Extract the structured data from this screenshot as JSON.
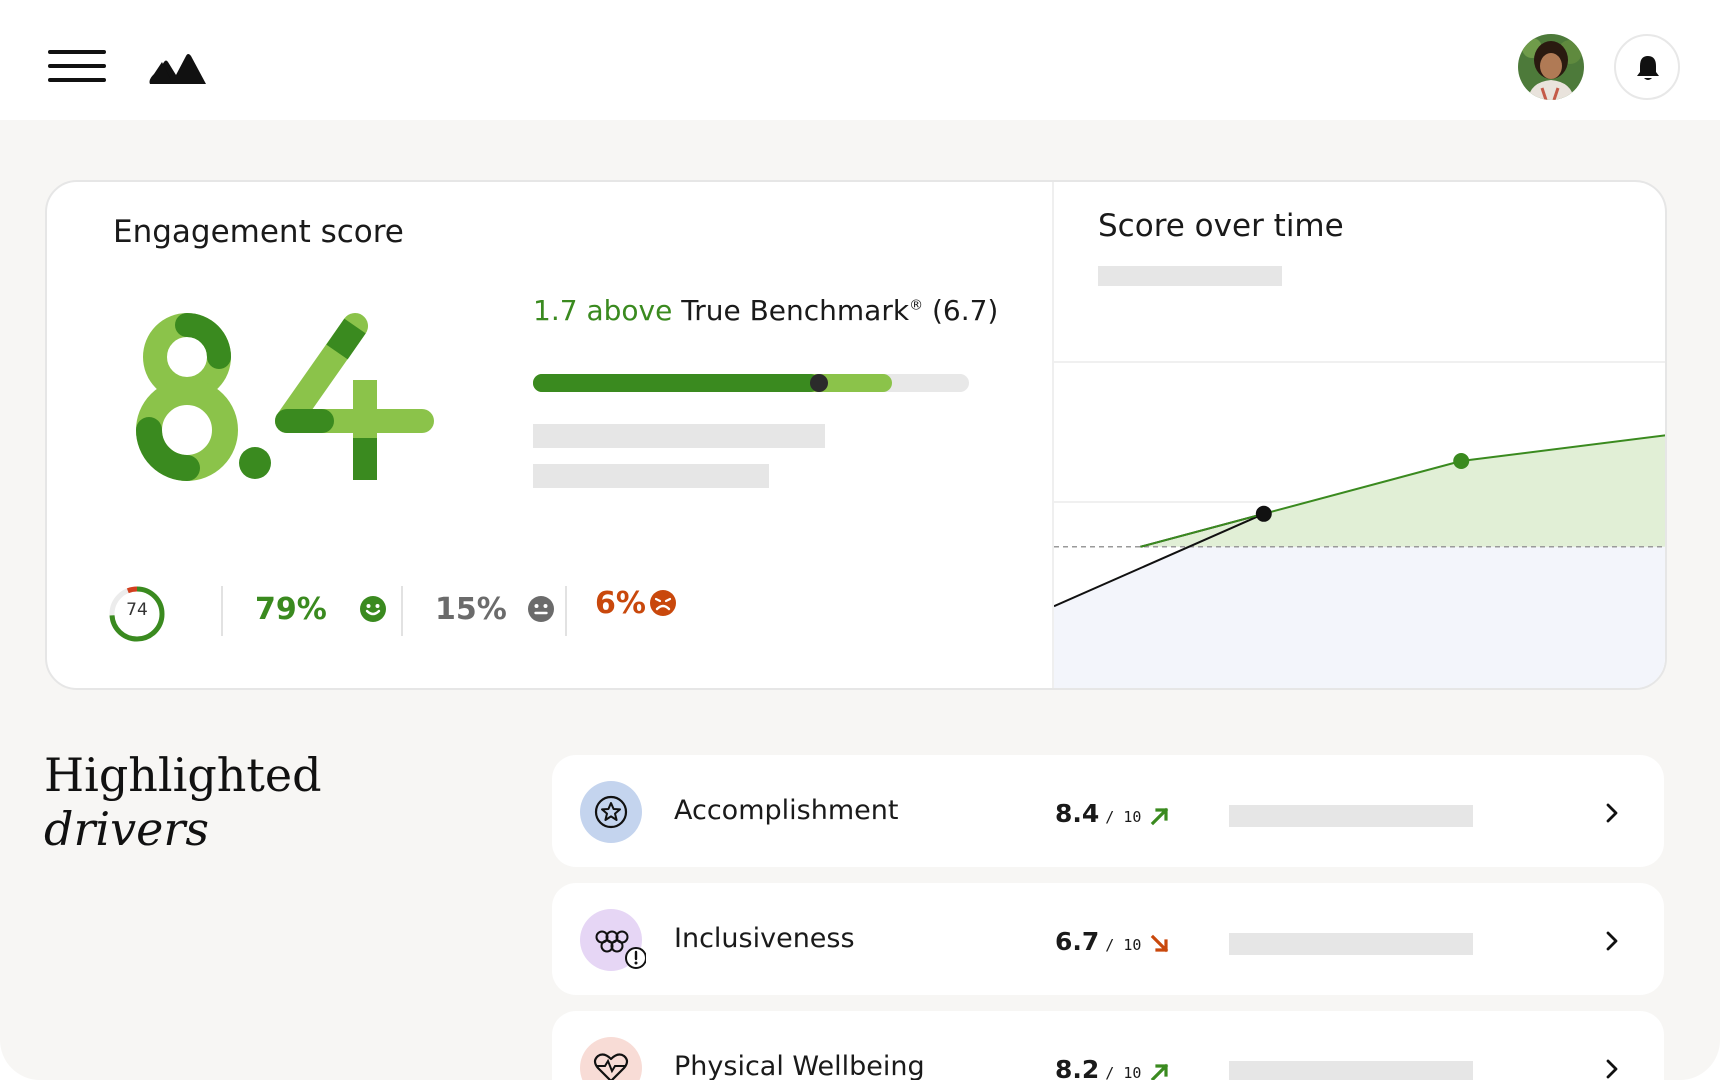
{
  "header": {
    "menu_icon": "hamburger-icon",
    "logo_icon": "mountain-logo-icon",
    "avatar_icon": "user-avatar",
    "notification_icon": "bell-icon"
  },
  "engagement": {
    "title": "Engagement score",
    "score": "8.4",
    "benchmark": {
      "delta": "1.7",
      "above_word": "above",
      "label": "True Benchmark",
      "registered": "®",
      "value_text": "(6.7)",
      "score_fraction": 0.84,
      "benchmark_fraction": 0.67
    },
    "participation": "74",
    "participation_fraction": 0.74,
    "sentiment": [
      {
        "value": "79%",
        "icon": "happy-face-icon",
        "color": "#3a8a1f"
      },
      {
        "value": "15%",
        "icon": "neutral-face-icon",
        "color": "#6b6b6b"
      },
      {
        "value": "6%",
        "icon": "sad-face-icon",
        "color": "#c9480c"
      }
    ]
  },
  "score_over_time": {
    "title": "Score over time"
  },
  "chart_data": {
    "type": "line",
    "title": "Score over time",
    "xlabel": "",
    "ylabel": "",
    "series": [
      {
        "values": [
          5.8,
          7.2,
          8.0,
          8.4
        ]
      }
    ],
    "benchmark": 6.7,
    "ylim": [
      4.5,
      9.5
    ],
    "grid": true
  },
  "highlighted": {
    "title_line1": "Highlighted",
    "title_line2": "drivers"
  },
  "drivers": [
    {
      "name": "Accomplishment",
      "score": "8.4",
      "out_of": "/ 10",
      "trend": "up",
      "icon": "star-badge-icon",
      "icon_bg": "#c4d4ee"
    },
    {
      "name": "Inclusiveness",
      "score": "6.7",
      "out_of": "/ 10",
      "trend": "down",
      "icon": "people-hex-icon",
      "icon_bg": "#e6d6f5"
    },
    {
      "name": "Physical Wellbeing",
      "score": "8.2",
      "out_of": "/ 10",
      "trend": "up",
      "icon": "heart-pulse-icon",
      "icon_bg": "#f8dcd6"
    }
  ],
  "colors": {
    "dark_green": "#3a8a1f",
    "light_green": "#8bc34a",
    "orange": "#c9480c",
    "background": "#f7f6f4"
  }
}
